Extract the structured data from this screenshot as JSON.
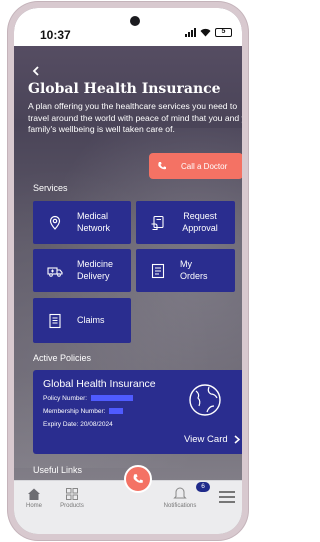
{
  "status_bar": {
    "time": "10:37",
    "battery": "5"
  },
  "header": {
    "back_icon": "back-arrow-icon",
    "title": "Global Health Insurance",
    "description": "A plan offering you the healthcare services you need to travel around the world with peace of mind that you and your family's wellbeing is well taken care of."
  },
  "call_button": {
    "label": "Call a Doctor",
    "icon": "phone-icon"
  },
  "services": {
    "title": "Services",
    "items": [
      {
        "label": "Medical Network",
        "icon": "location-pin-icon"
      },
      {
        "label": "Request Approval",
        "icon": "hand-document-icon"
      },
      {
        "label": "Medicine Delivery",
        "icon": "ambulance-icon"
      },
      {
        "label": "My Orders",
        "icon": "order-list-icon"
      },
      {
        "label": "Claims",
        "icon": "claims-document-icon"
      }
    ]
  },
  "active_policies": {
    "title": "Active Policies",
    "policy": {
      "name": "Global Health Insurance",
      "policy_number_label": "Policy Number:",
      "membership_number_label": "Membership Number:",
      "expiry": "Expiry Date: 20/08/2024",
      "view_card": "View Card",
      "icon": "globe-icon"
    }
  },
  "useful_links": {
    "title": "Useful Links"
  },
  "bottom_nav": {
    "items": [
      {
        "label": "Home",
        "icon": "home-icon"
      },
      {
        "label": "Products",
        "icon": "grid-icon"
      },
      {
        "label": "Notifications",
        "icon": "notifications-icon"
      }
    ],
    "notification_count": "6",
    "fab_icon": "phone-icon",
    "menu_icon": "hamburger-menu-icon"
  },
  "colors": {
    "accent": "#f47264",
    "card": "#2a2d8f",
    "badge": "#1f2a8a"
  }
}
